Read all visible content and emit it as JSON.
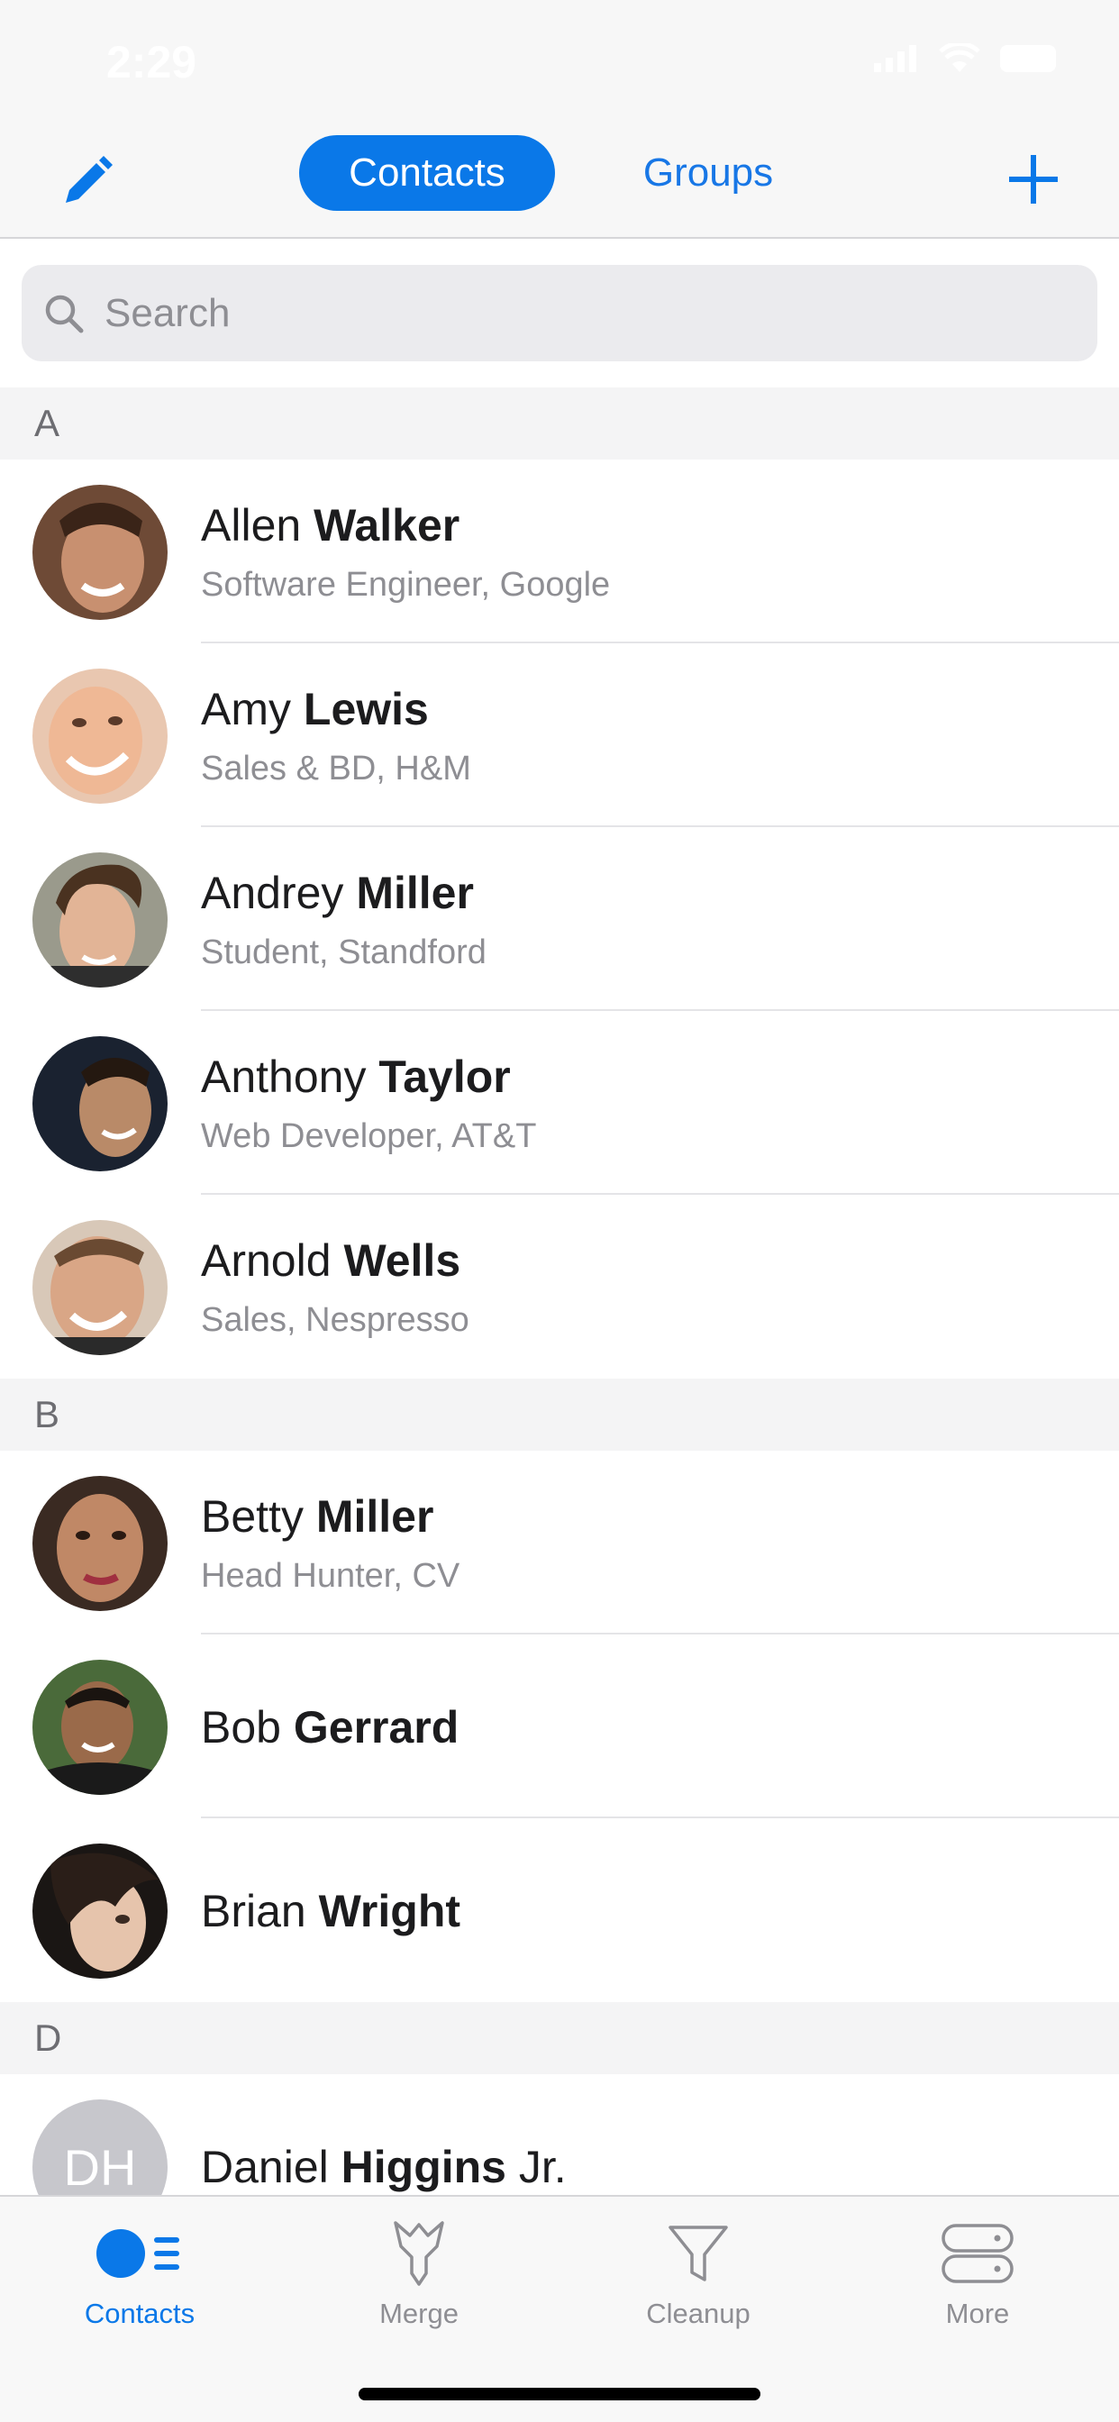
{
  "status_bar": {
    "time": "2:29"
  },
  "nav": {
    "tabs": [
      {
        "label": "Contacts",
        "selected": true
      },
      {
        "label": "Groups",
        "selected": false
      }
    ]
  },
  "search": {
    "placeholder": "Search"
  },
  "sections": [
    {
      "letter": "A",
      "contacts": [
        {
          "first": "Allen",
          "last": "Walker",
          "subtitle": "Software Engineer, Google"
        },
        {
          "first": "Amy",
          "last": "Lewis",
          "subtitle": "Sales & BD, H&M"
        },
        {
          "first": "Andrey",
          "last": "Miller",
          "subtitle": "Student, Standford"
        },
        {
          "first": "Anthony",
          "last": "Taylor",
          "subtitle": "Web Developer, AT&T"
        },
        {
          "first": "Arnold",
          "last": "Wells",
          "subtitle": "Sales, Nespresso"
        }
      ]
    },
    {
      "letter": "B",
      "contacts": [
        {
          "first": "Betty",
          "last": "Miller",
          "subtitle": "Head Hunter, CV"
        },
        {
          "first": "Bob",
          "last": "Gerrard"
        },
        {
          "first": "Brian",
          "last": "Wright"
        }
      ]
    },
    {
      "letter": "D",
      "contacts": [
        {
          "first": "Daniel",
          "last": "Higgins",
          "suffix": "Jr.",
          "initials": "DH"
        }
      ]
    }
  ],
  "tab_bar": {
    "items": [
      {
        "label": "Contacts",
        "icon": "contacts-icon",
        "active": true
      },
      {
        "label": "Merge",
        "icon": "merge-icon",
        "active": false
      },
      {
        "label": "Cleanup",
        "icon": "filter-icon",
        "active": false
      },
      {
        "label": "More",
        "icon": "more-icon",
        "active": false
      }
    ]
  },
  "colors": {
    "accent": "#0a78e8",
    "secondary_text": "#8e8e93",
    "section_bg": "#f4f4f5"
  }
}
